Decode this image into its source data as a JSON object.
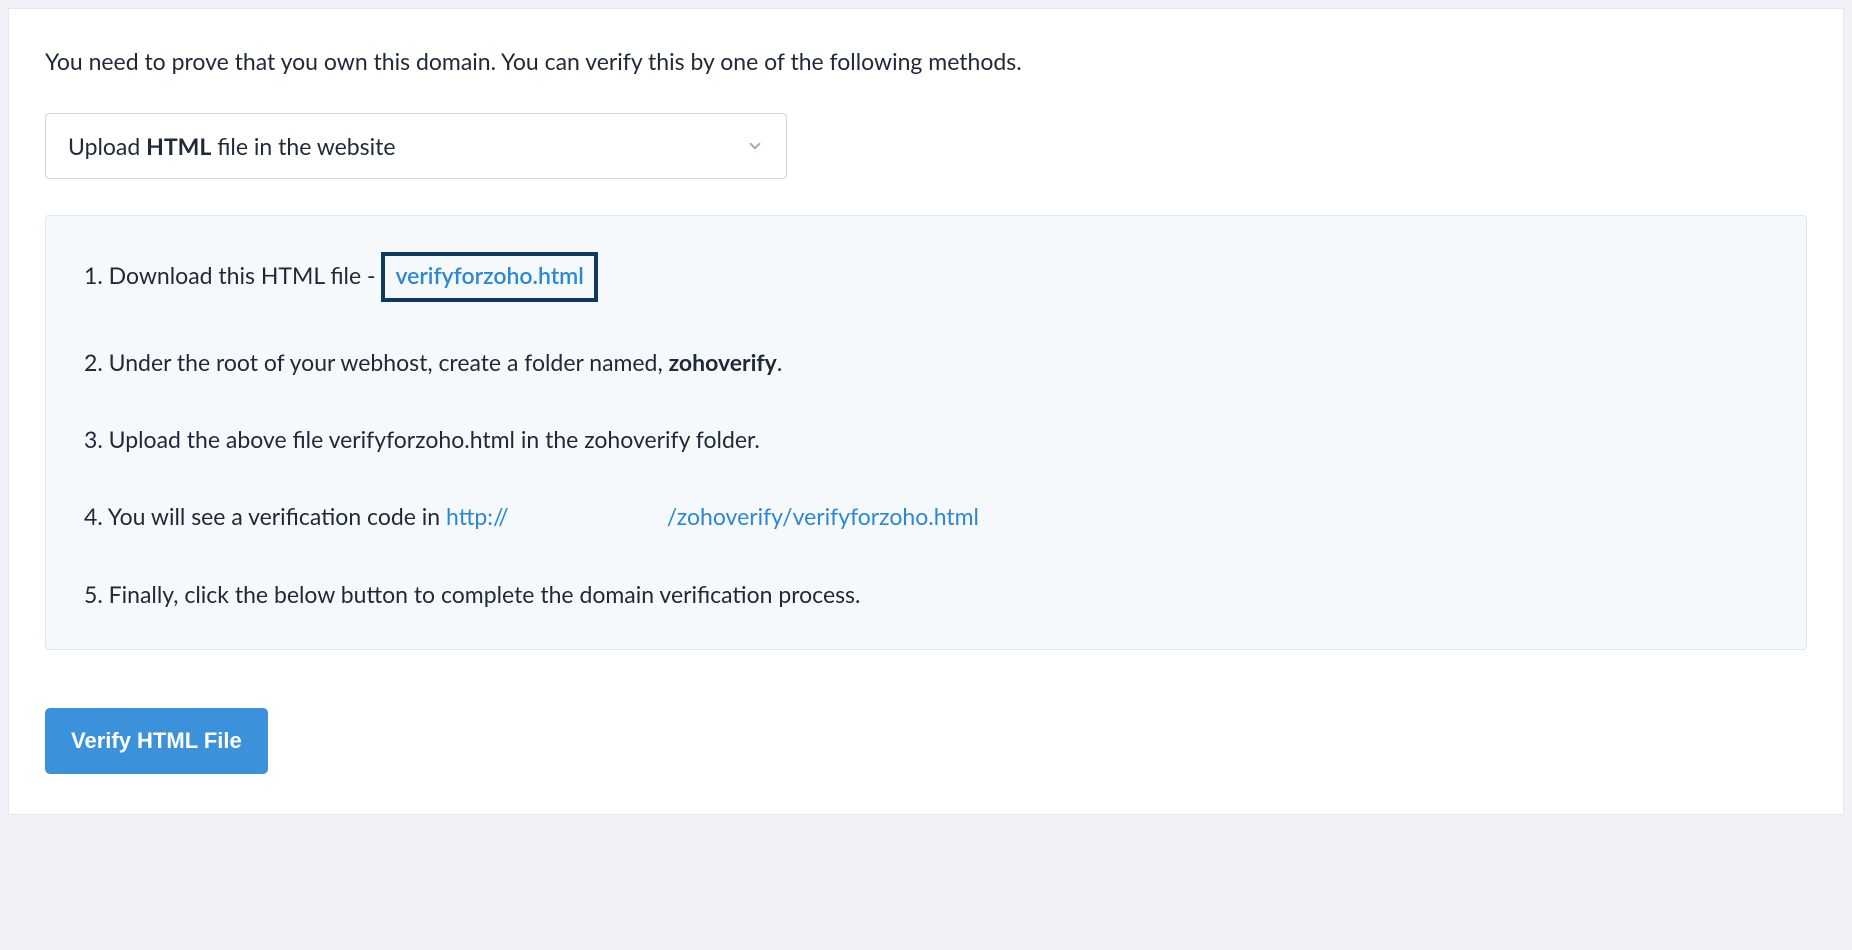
{
  "intro": "You need to prove that you own this domain. You can verify this by one of the following methods.",
  "dropdown": {
    "prefix": "Upload ",
    "bold": "HTML",
    "suffix": " file in the website"
  },
  "steps": {
    "s1_prefix": "1. Download this HTML file - ",
    "s1_filename": "verifyforzoho.html",
    "s2_prefix": "2. Under the root of your webhost, create a folder named, ",
    "s2_bold": "zohoverify",
    "s2_suffix": ".",
    "s3": "3. Upload the above file verifyforzoho.html in the zohoverify folder.",
    "s4_prefix": "4. You will see a verification code in ",
    "s4_url_protocol": "http://",
    "s4_url_path": "/zohoverify/verifyforzoho.html",
    "s5": "5. Finally, click the below button to complete the domain verification process."
  },
  "button": {
    "label": "Verify HTML File"
  }
}
